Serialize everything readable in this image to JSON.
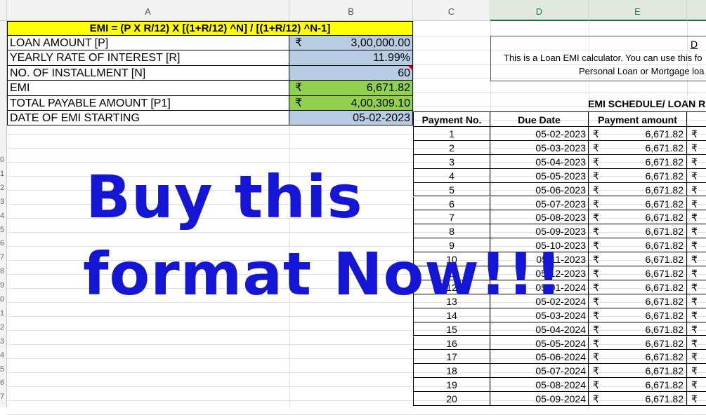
{
  "columns": [
    "A",
    "B",
    "C",
    "D",
    "E"
  ],
  "row_numbers": [
    "0",
    "1",
    "2",
    "3",
    "4",
    "5",
    "6",
    "7",
    "8",
    "9",
    "0",
    "1",
    "2",
    "3",
    "4",
    "5",
    "6",
    "7"
  ],
  "formula_header": "EMI = (P X R/12) X [(1+R/12) ^N] / [(1+R/12) ^N-1]",
  "inputs": [
    {
      "label": "LOAN AMOUNT [P]",
      "currency": "₹",
      "value": "3,00,000.00"
    },
    {
      "label": "YEARLY RATE OF INTEREST [R]",
      "currency": "",
      "value": "11.99%"
    },
    {
      "label": "NO. OF INSTALLMENT [N]",
      "currency": "",
      "value": "60"
    },
    {
      "label": "EMI",
      "currency": "₹",
      "value": "6,671.82"
    },
    {
      "label": "TOTAL PAYABLE AMOUNT [P1]",
      "currency": "₹",
      "value": "4,00,309.10"
    },
    {
      "label": "DATE OF EMI STARTING",
      "currency": "",
      "value": "05-02-2023"
    }
  ],
  "description": {
    "title_partial": "D",
    "line1": "This is a Loan EMI calculator. You can use this fo",
    "line2": "Personal Loan or Mortgage loa"
  },
  "schedule": {
    "title": "EMI SCHEDULE/ LOAN RE",
    "headers": [
      "Payment No.",
      "Due Date",
      "Payment amount"
    ],
    "currency": "₹",
    "rows": [
      {
        "no": "1",
        "date": "05-02-2023",
        "amount": "6,671.82"
      },
      {
        "no": "2",
        "date": "05-03-2023",
        "amount": "6,671.82"
      },
      {
        "no": "3",
        "date": "05-04-2023",
        "amount": "6,671.82"
      },
      {
        "no": "4",
        "date": "05-05-2023",
        "amount": "6,671.82"
      },
      {
        "no": "5",
        "date": "05-06-2023",
        "amount": "6,671.82"
      },
      {
        "no": "6",
        "date": "05-07-2023",
        "amount": "6,671.82"
      },
      {
        "no": "7",
        "date": "05-08-2023",
        "amount": "6,671.82"
      },
      {
        "no": "8",
        "date": "05-09-2023",
        "amount": "6,671.82"
      },
      {
        "no": "9",
        "date": "05-10-2023",
        "amount": "6,671.82"
      },
      {
        "no": "10",
        "date": "05-11-2023",
        "amount": "6,671.82"
      },
      {
        "no": "11",
        "date": "05-12-2023",
        "amount": "6,671.82"
      },
      {
        "no": "12",
        "date": "05-01-2024",
        "amount": "6,671.82"
      },
      {
        "no": "13",
        "date": "05-02-2024",
        "amount": "6,671.82"
      },
      {
        "no": "14",
        "date": "05-03-2024",
        "amount": "6,671.82"
      },
      {
        "no": "15",
        "date": "05-04-2024",
        "amount": "6,671.82"
      },
      {
        "no": "16",
        "date": "05-05-2024",
        "amount": "6,671.82"
      },
      {
        "no": "17",
        "date": "05-06-2024",
        "amount": "6,671.82"
      },
      {
        "no": "18",
        "date": "05-07-2024",
        "amount": "6,671.82"
      },
      {
        "no": "19",
        "date": "05-08-2024",
        "amount": "6,671.82"
      },
      {
        "no": "20",
        "date": "05-09-2024",
        "amount": "6,671.82"
      }
    ]
  },
  "watermark": {
    "line1": "Buy this",
    "line2": "format Now!!!"
  },
  "colors": {
    "yellow": "#ffff00",
    "blue_cell": "#b8cce4",
    "green_cell": "#92d050",
    "watermark": "#1515d6"
  }
}
